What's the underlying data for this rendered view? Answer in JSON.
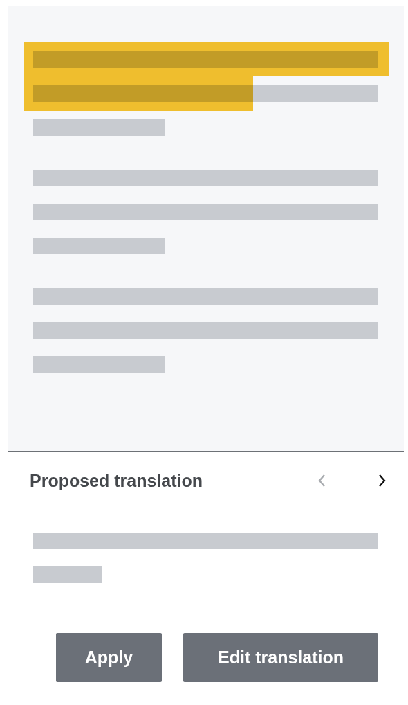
{
  "proposed_translation": {
    "title": "Proposed translation",
    "navigation": [
      {
        "kind": "previous",
        "disabled": true
      },
      {
        "kind": "next",
        "disabled": false
      }
    ]
  },
  "buttons": [
    {
      "label": "Apply"
    },
    {
      "label": "Edit translation"
    }
  ]
}
